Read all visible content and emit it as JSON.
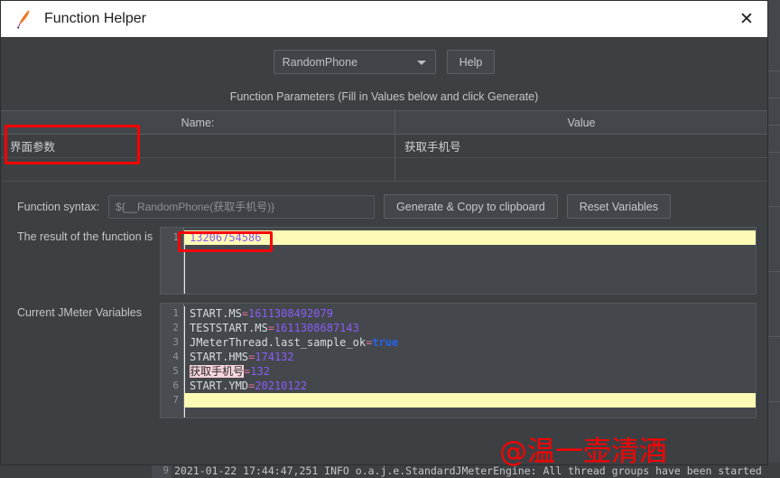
{
  "window": {
    "title": "Function Helper",
    "icon": "jmeter-feather-icon",
    "close_label": "✕"
  },
  "toolbar": {
    "function_selected": "RandomPhone",
    "help_label": "Help",
    "dropdown_icon": "chevron-down-icon"
  },
  "parameters": {
    "caption": "Function Parameters (Fill in Values below and click Generate)",
    "columns": [
      "Name:",
      "Value"
    ],
    "rows": [
      {
        "name": "界面参数",
        "value": "获取手机号"
      },
      {
        "name": "",
        "value": ""
      }
    ]
  },
  "syntax": {
    "label": "Function syntax:",
    "value": "${__RandomPhone(获取手机号)}",
    "generate_label": "Generate & Copy to clipboard",
    "reset_label": "Reset Variables"
  },
  "result": {
    "label": "The result of the function is",
    "lines": [
      "13206754586"
    ],
    "line_numbers": [
      "1"
    ]
  },
  "variables": {
    "label": "Current JMeter Variables",
    "line_numbers": [
      "1",
      "2",
      "3",
      "4",
      "5",
      "6",
      "7"
    ],
    "entries": [
      {
        "key": "START.MS",
        "value": "1611308492079",
        "type": "number"
      },
      {
        "key": "TESTSTART.MS",
        "value": "1611308687143",
        "type": "number"
      },
      {
        "key": "JMeterThread.last_sample_ok",
        "value": "true",
        "type": "boolean"
      },
      {
        "key": "START.HMS",
        "value": "174132",
        "type": "number"
      },
      {
        "key": "获取手机号",
        "value": "132",
        "type": "number",
        "highlight_key": true
      },
      {
        "key": "START.YMD",
        "value": "20210122",
        "type": "number"
      }
    ]
  },
  "watermark": {
    "text": "@温一壶清酒",
    "color": "#ff0000"
  },
  "background_log": {
    "line_number": "9",
    "text": "2021-01-22 17:44:47,251 INFO o.a.j.e.StandardJMeterEngine: All thread groups have been started"
  },
  "annotations": [
    {
      "name": "interface-parameter-highlight",
      "color": "#fe0000"
    },
    {
      "name": "result-value-highlight",
      "color": "#fe0000"
    }
  ],
  "colors": {
    "background": "#3c4043",
    "titlebar": "#ffffff",
    "highlight_yellow": "#fcfab4",
    "value_purple": "#8b5cf6",
    "boolean_blue": "#2563eb",
    "annotation_red": "#fe0000"
  }
}
